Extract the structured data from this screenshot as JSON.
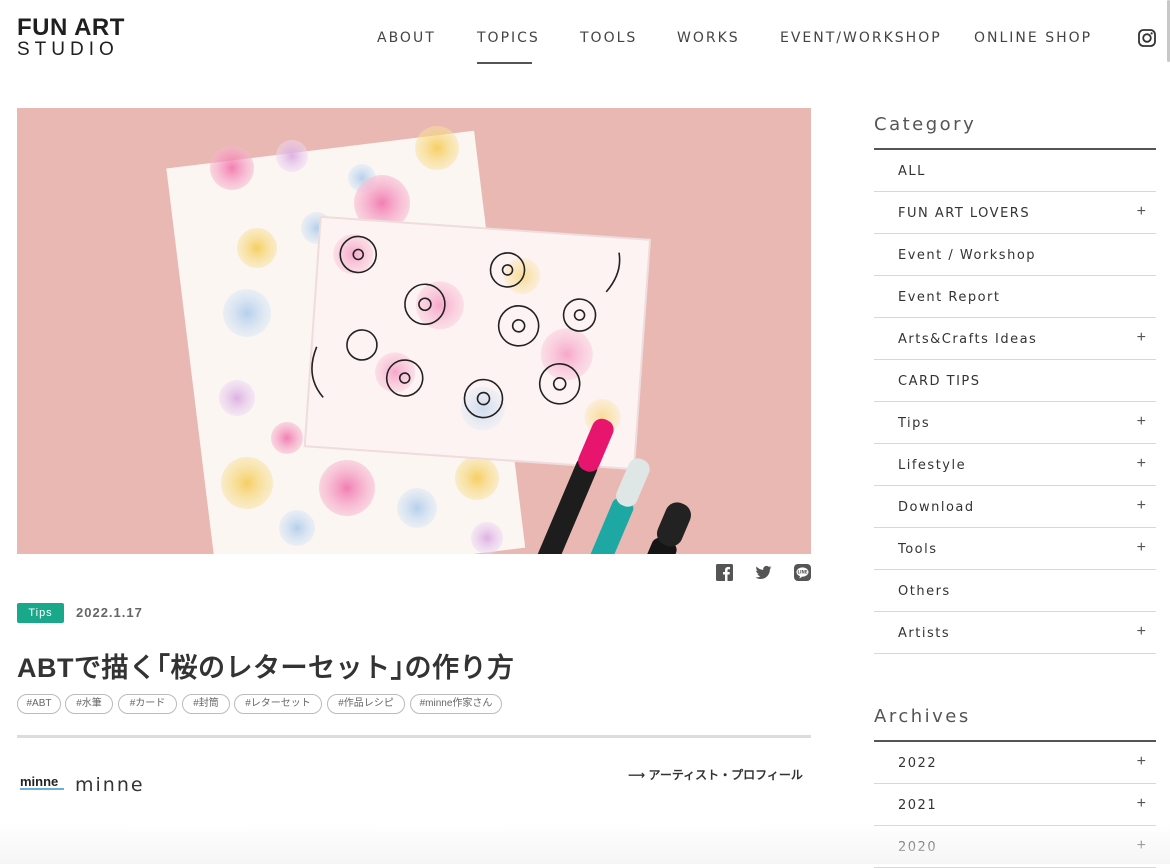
{
  "logo": {
    "line1": "FUN ART",
    "line2": "STUDIO"
  },
  "nav": [
    {
      "label": "ABOUT"
    },
    {
      "label": "TOPICS"
    },
    {
      "label": "TOOLS"
    },
    {
      "label": "WORKS"
    },
    {
      "label": "EVENT/WORKSHOP"
    },
    {
      "label": "ONLINE SHOP"
    }
  ],
  "active_nav": "TOPICS",
  "icons": {
    "instagram": "instagram-icon",
    "facebook": "facebook-icon",
    "twitter": "twitter-icon",
    "line": "line-icon"
  },
  "article": {
    "category_badge": "Tips",
    "date": "2022.1.17",
    "title": "ABTで描く｢桜のレターセット｣の作り方",
    "hashtags": [
      "#ABT",
      "#水筆",
      "#カード",
      "#封筒",
      "#レターセット",
      "#作品レシピ",
      "#minne作家さん"
    ],
    "author_logo": "minne",
    "author_name": "minne",
    "profile_link": "⟶ アーティスト・プロフィール"
  },
  "colors": {
    "accent": "#1aa88a",
    "hero_bg": "#e7b6b1",
    "text": "#333333"
  },
  "sidebar": {
    "category_heading": "Category",
    "categories": [
      {
        "label": "ALL",
        "expandable": false
      },
      {
        "label": "FUN ART LOVERS",
        "expandable": true
      },
      {
        "label": "Event / Workshop",
        "expandable": false
      },
      {
        "label": "Event Report",
        "expandable": false
      },
      {
        "label": "Arts&Crafts Ideas",
        "expandable": true
      },
      {
        "label": "CARD TIPS",
        "expandable": false
      },
      {
        "label": "Tips",
        "expandable": true
      },
      {
        "label": "Lifestyle",
        "expandable": true
      },
      {
        "label": "Download",
        "expandable": true
      },
      {
        "label": "Tools",
        "expandable": true
      },
      {
        "label": "Others",
        "expandable": false
      },
      {
        "label": "Artists",
        "expandable": true
      }
    ],
    "archives_heading": "Archives",
    "archives": [
      {
        "label": "2022",
        "expandable": true
      },
      {
        "label": "2021",
        "expandable": true
      },
      {
        "label": "2020",
        "expandable": true
      }
    ],
    "plus_symbol": "+"
  }
}
